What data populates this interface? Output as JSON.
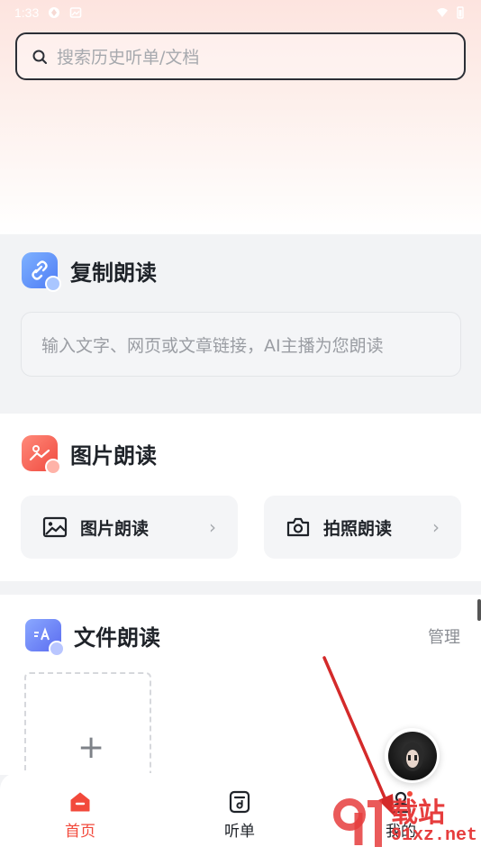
{
  "status_bar": {
    "time": "1:33"
  },
  "search": {
    "placeholder": "搜索历史听单/文档"
  },
  "copy_read": {
    "title": "复制朗读",
    "input_placeholder": "输入文字、网页或文章链接，AI主播为您朗读"
  },
  "image_read": {
    "title": "图片朗读",
    "cards": [
      {
        "label": "图片朗读",
        "icon": "image-icon"
      },
      {
        "label": "拍照朗读",
        "icon": "camera-icon"
      }
    ]
  },
  "file_read": {
    "title": "文件朗读",
    "manage_label": "管理"
  },
  "bottom_nav": {
    "items": [
      {
        "label": "首页",
        "icon": "home-icon",
        "active": true
      },
      {
        "label": "听单",
        "icon": "playlist-icon",
        "active": false
      },
      {
        "label": "我的",
        "icon": "profile-icon",
        "active": false
      }
    ]
  },
  "watermark": {
    "brand": "载站",
    "domain": "91xz.net"
  },
  "colors": {
    "accent": "#f2493b",
    "arrow": "#d42a2a"
  }
}
